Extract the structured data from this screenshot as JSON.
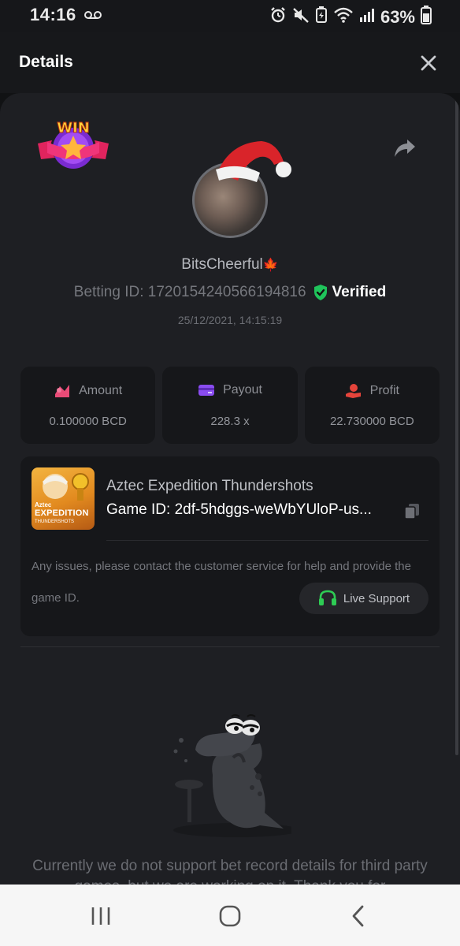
{
  "status_bar": {
    "time": "14:16",
    "battery": "63%",
    "icons": [
      "voicemail-icon",
      "alarm-icon",
      "mute-icon",
      "battery-saver-icon",
      "wifi-icon",
      "signal-icon",
      "battery-icon"
    ]
  },
  "header": {
    "title": "Details",
    "close_icon": "close-icon"
  },
  "profile": {
    "username": "BitsCheerful",
    "username_emoji": "🍁",
    "betting_id": "Betting ID: 1720154240566194816",
    "verified_label": "Verified",
    "datetime": "25/12/2021, 14:15:19",
    "badge_text": "WIN"
  },
  "stats": {
    "amount": {
      "label": "Amount",
      "value": "0.100000 BCD"
    },
    "payout": {
      "label": "Payout",
      "value": "228.3 x"
    },
    "profit": {
      "label": "Profit",
      "value": "22.730000 BCD"
    }
  },
  "game": {
    "name": "Aztec Expedition Thundershots",
    "game_id": "Game ID: 2df-5hdggs-weWbYUloP-us...",
    "thumb_line1": "Aztec",
    "thumb_line2": "EXPEDITION",
    "thumb_line3": "THUNDERSHOTS",
    "support_text": "Any issues, please contact the customer service for help and provide the game ID.",
    "live_support_label": "Live Support"
  },
  "notice": "Currently we do not support bet record details for third party games, but we are working on it. Thank you for",
  "colors": {
    "background": "#111214",
    "sheet": "#1e1f23",
    "card": "#16171a",
    "verified_green": "#1fc45b",
    "amount_pink": "#e94b77",
    "payout_purple": "#8a4cf0",
    "profit_red": "#e5443b",
    "support_green": "#2ecc54"
  }
}
